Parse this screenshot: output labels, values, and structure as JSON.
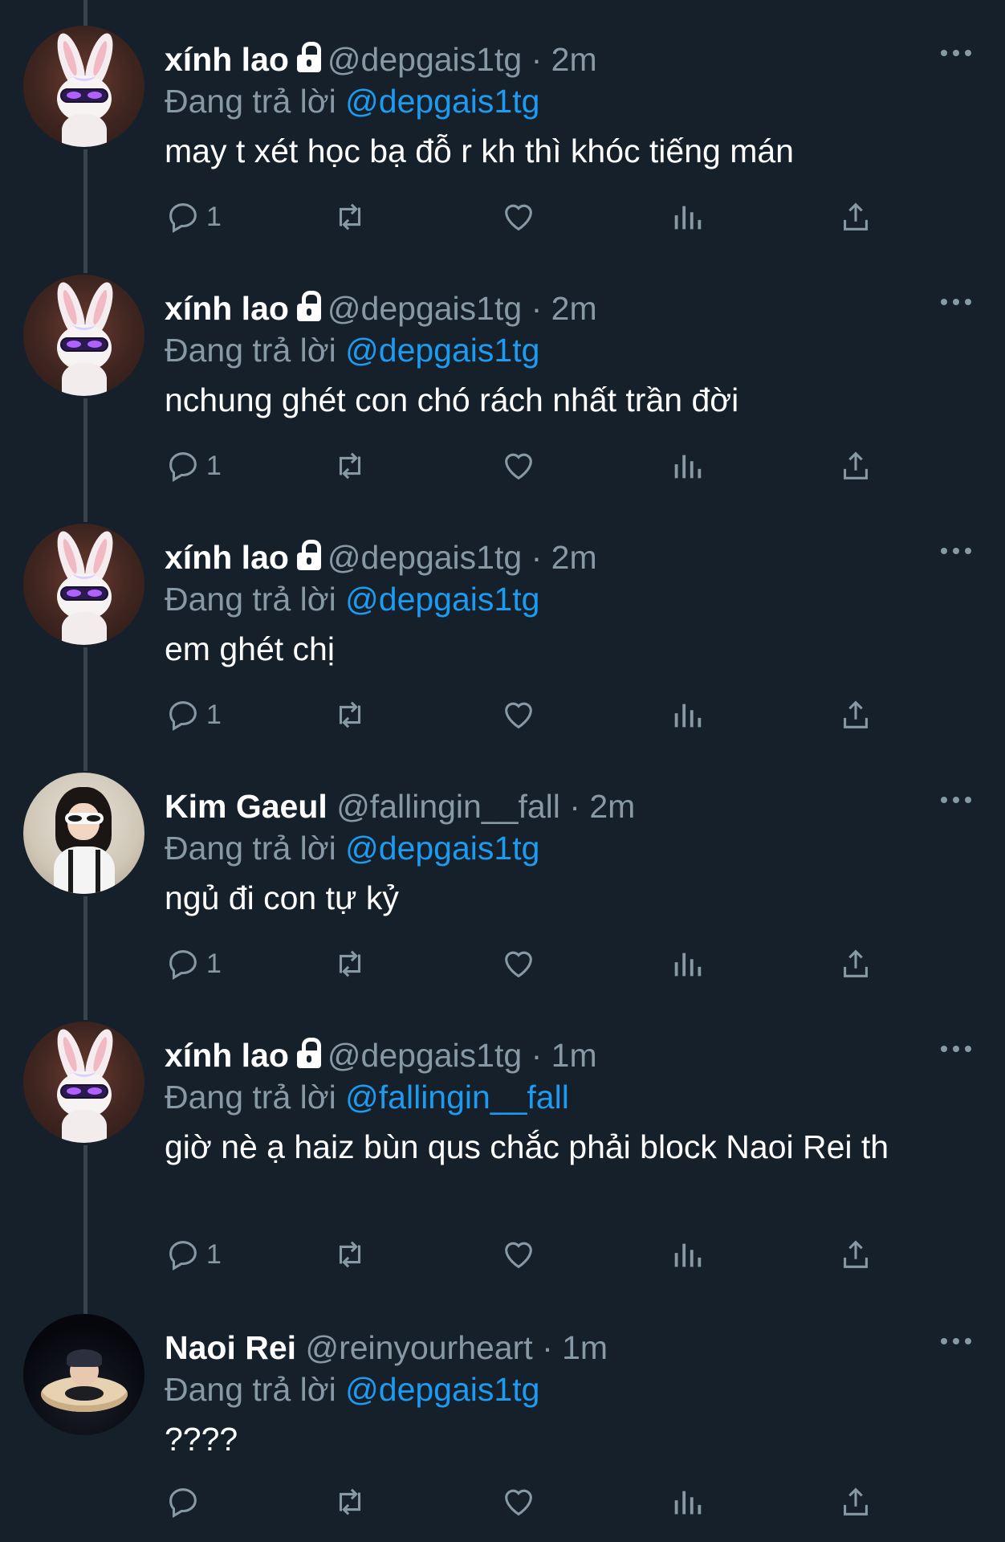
{
  "colors": {
    "background": "#15202b",
    "muted": "#8899a6",
    "mention": "#1d9bf0",
    "thread_line": "#38444d"
  },
  "icons": {
    "reply": "reply-icon",
    "retweet": "retweet-icon",
    "like": "heart-icon",
    "views": "analytics-icon",
    "share": "share-icon",
    "more": "more-icon",
    "lock": "lock-icon"
  },
  "tweets": [
    {
      "name": "xính lao",
      "locked": true,
      "handle": "@depgais1tg",
      "sep": "·",
      "time": "2m",
      "reply_prefix": "Đang trả lời",
      "reply_to": "@depgais1tg",
      "text": "may t xét học bạ đỗ r kh thì khóc tiếng mán",
      "reply_count": "1"
    },
    {
      "name": "xính lao",
      "locked": true,
      "handle": "@depgais1tg",
      "sep": "·",
      "time": "2m",
      "reply_prefix": "Đang trả lời",
      "reply_to": "@depgais1tg",
      "text": "nchung ghét con chó rách nhất trần đời",
      "reply_count": "1"
    },
    {
      "name": "xính lao",
      "locked": true,
      "handle": "@depgais1tg",
      "sep": "·",
      "time": "2m",
      "reply_prefix": "Đang trả lời",
      "reply_to": "@depgais1tg",
      "text": "em ghét chị",
      "reply_count": "1"
    },
    {
      "name": "Kim Gaeul",
      "locked": false,
      "handle": "@fallingin__fall",
      "sep": "·",
      "time": "2m",
      "reply_prefix": "Đang trả lời",
      "reply_to": "@depgais1tg",
      "text": "ngủ đi con tự kỷ",
      "reply_count": "1"
    },
    {
      "name": "xính lao",
      "locked": true,
      "handle": "@depgais1tg",
      "sep": "·",
      "time": "1m",
      "reply_prefix": "Đang trả lời",
      "reply_to": "@fallingin__fall",
      "text": "giờ nè ạ haiz bùn qus chắc phải block Naoi Rei th",
      "reply_count": "1"
    },
    {
      "name": "Naoi Rei",
      "locked": false,
      "handle": "@reinyourheart",
      "sep": "·",
      "time": "1m",
      "reply_prefix": "Đang trả lời",
      "reply_to": "@depgais1tg",
      "text": "????",
      "reply_count": ""
    }
  ]
}
